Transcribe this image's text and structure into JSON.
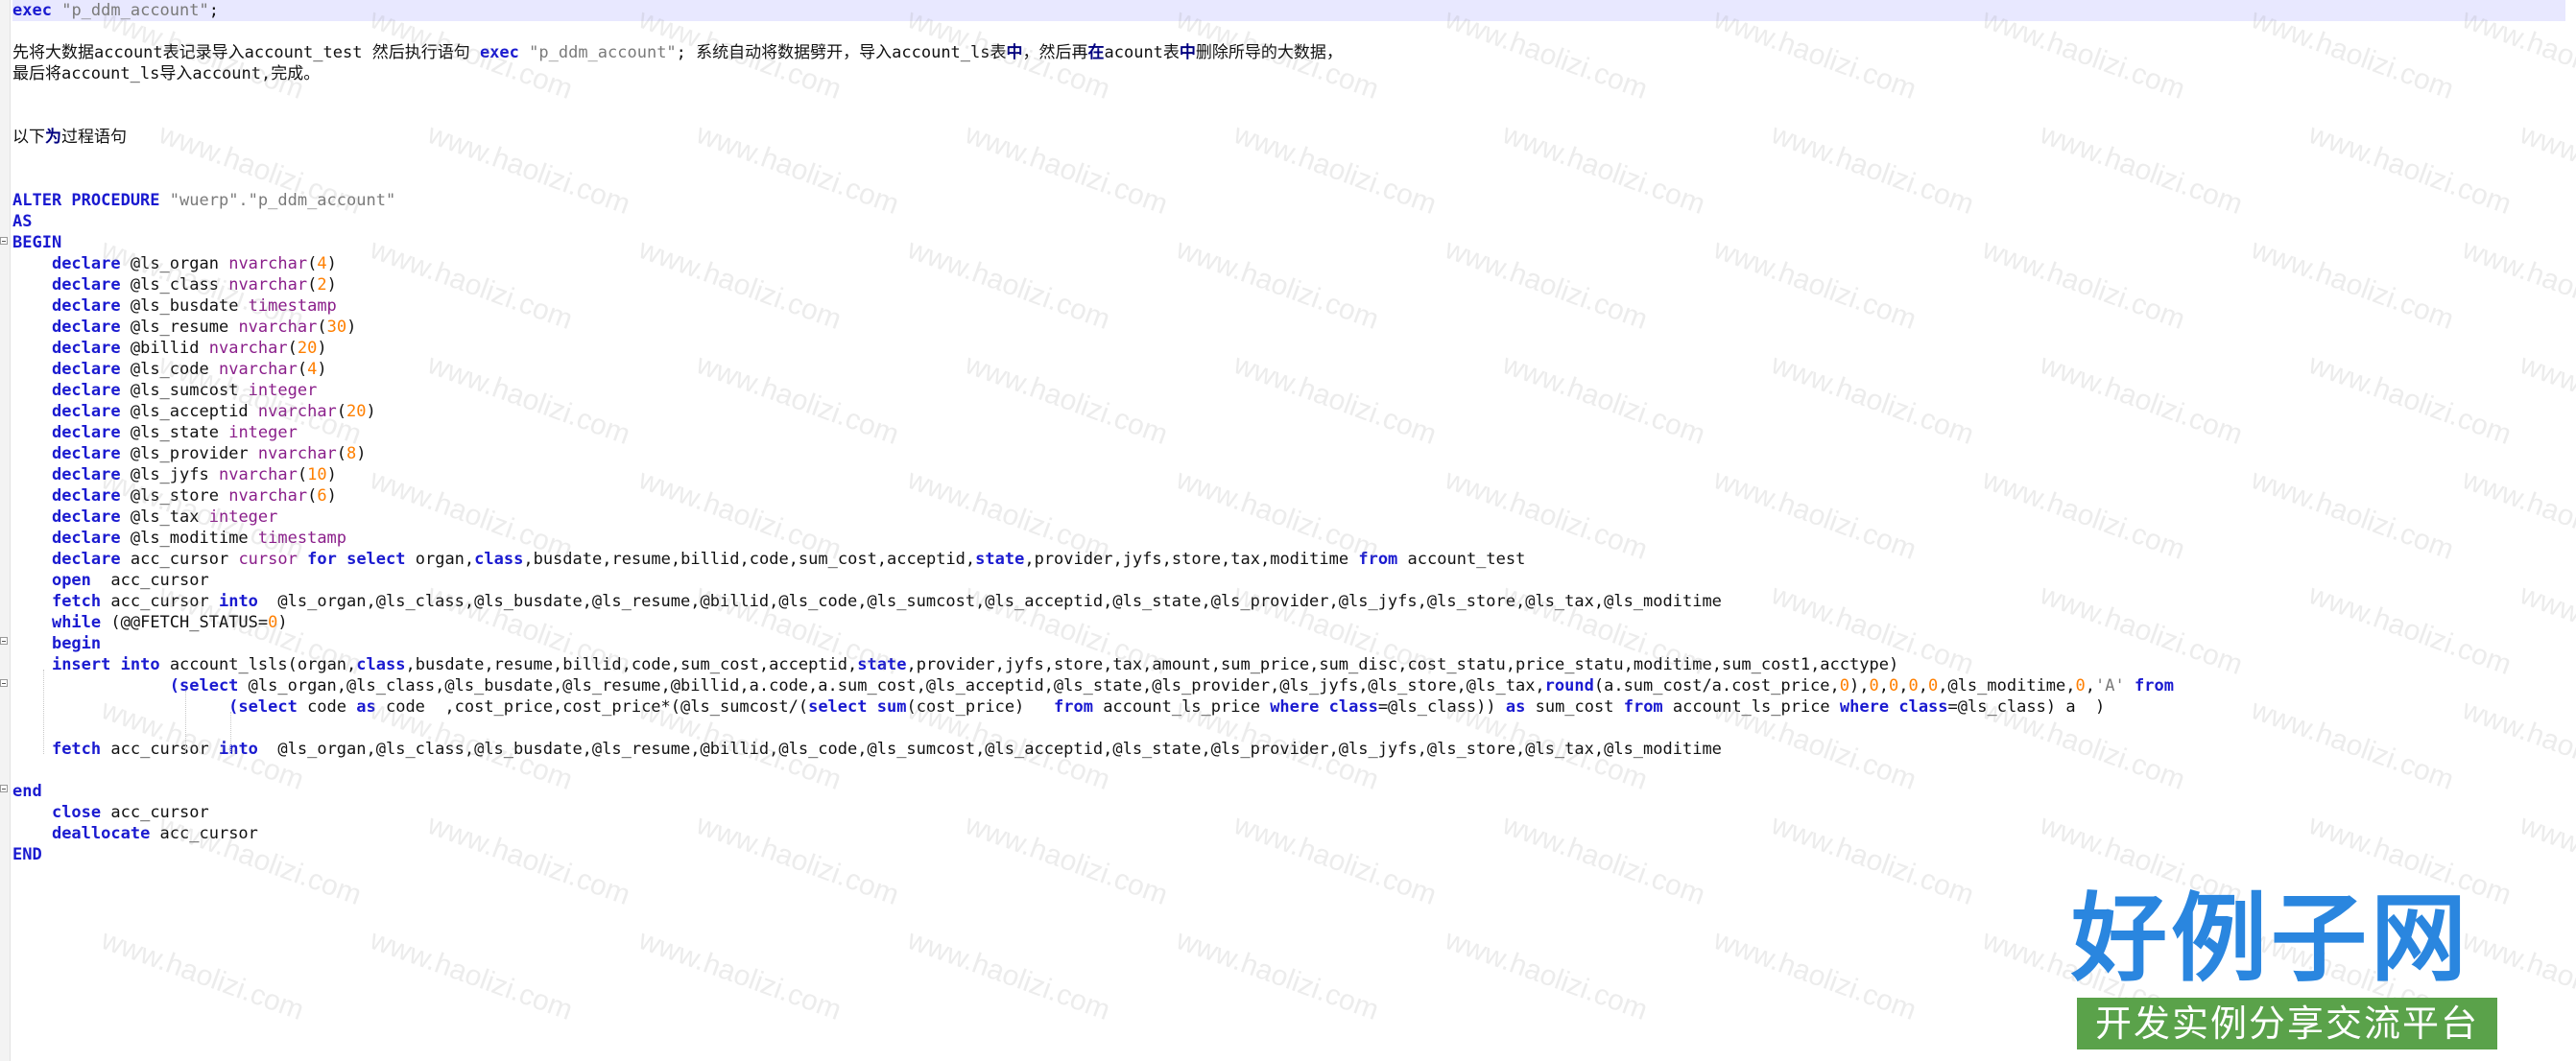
{
  "editor": {
    "lines": [
      [
        {
          "c": "kw",
          "t": "exec"
        },
        {
          "c": "tx",
          "t": " "
        },
        {
          "c": "st",
          "t": "\"p_ddm_account\""
        },
        {
          "c": "tx",
          "t": ";"
        }
      ],
      [],
      [
        {
          "c": "tx",
          "t": "先将大数据account表记录导入account_test 然后执行语句 "
        },
        {
          "c": "kw",
          "t": "exec"
        },
        {
          "c": "tx",
          "t": " "
        },
        {
          "c": "st",
          "t": "\"p_ddm_account\""
        },
        {
          "c": "tx",
          "t": "; 系统自动将数据劈开，导入account_ls表"
        },
        {
          "c": "op",
          "t": "中"
        },
        {
          "c": "tx",
          "t": "，然后再"
        },
        {
          "c": "op",
          "t": "在"
        },
        {
          "c": "tx",
          "t": "acount表"
        },
        {
          "c": "op",
          "t": "中"
        },
        {
          "c": "tx",
          "t": "删除所导的大数据，"
        }
      ],
      [
        {
          "c": "tx",
          "t": "最后将account_ls导入account,完成。"
        }
      ],
      [],
      [],
      [
        {
          "c": "tx",
          "t": "以下"
        },
        {
          "c": "op",
          "t": "为"
        },
        {
          "c": "tx",
          "t": "过程语句"
        }
      ],
      [],
      [],
      [
        {
          "c": "kw",
          "t": "ALTER PROCEDURE"
        },
        {
          "c": "tx",
          "t": " "
        },
        {
          "c": "st",
          "t": "\"wuerp\".\"p_ddm_account\""
        }
      ],
      [
        {
          "c": "kw",
          "t": "AS"
        }
      ],
      [
        {
          "c": "kw",
          "t": "BEGIN"
        }
      ],
      [
        {
          "c": "tx",
          "t": "    "
        },
        {
          "c": "kw",
          "t": "declare"
        },
        {
          "c": "tx",
          "t": " @ls_organ "
        },
        {
          "c": "ty",
          "t": "nvarchar"
        },
        {
          "c": "tx",
          "t": "("
        },
        {
          "c": "nm",
          "t": "4"
        },
        {
          "c": "tx",
          "t": ")"
        }
      ],
      [
        {
          "c": "tx",
          "t": "    "
        },
        {
          "c": "kw",
          "t": "declare"
        },
        {
          "c": "tx",
          "t": " @ls_class "
        },
        {
          "c": "ty",
          "t": "nvarchar"
        },
        {
          "c": "tx",
          "t": "("
        },
        {
          "c": "nm",
          "t": "2"
        },
        {
          "c": "tx",
          "t": ")"
        }
      ],
      [
        {
          "c": "tx",
          "t": "    "
        },
        {
          "c": "kw",
          "t": "declare"
        },
        {
          "c": "tx",
          "t": " @ls_busdate "
        },
        {
          "c": "ty",
          "t": "timestamp"
        }
      ],
      [
        {
          "c": "tx",
          "t": "    "
        },
        {
          "c": "kw",
          "t": "declare"
        },
        {
          "c": "tx",
          "t": " @ls_resume "
        },
        {
          "c": "ty",
          "t": "nvarchar"
        },
        {
          "c": "tx",
          "t": "("
        },
        {
          "c": "nm",
          "t": "30"
        },
        {
          "c": "tx",
          "t": ")"
        }
      ],
      [
        {
          "c": "tx",
          "t": "    "
        },
        {
          "c": "kw",
          "t": "declare"
        },
        {
          "c": "tx",
          "t": " @billid "
        },
        {
          "c": "ty",
          "t": "nvarchar"
        },
        {
          "c": "tx",
          "t": "("
        },
        {
          "c": "nm",
          "t": "20"
        },
        {
          "c": "tx",
          "t": ")"
        }
      ],
      [
        {
          "c": "tx",
          "t": "    "
        },
        {
          "c": "kw",
          "t": "declare"
        },
        {
          "c": "tx",
          "t": " @ls_code "
        },
        {
          "c": "ty",
          "t": "nvarchar"
        },
        {
          "c": "tx",
          "t": "("
        },
        {
          "c": "nm",
          "t": "4"
        },
        {
          "c": "tx",
          "t": ")"
        }
      ],
      [
        {
          "c": "tx",
          "t": "    "
        },
        {
          "c": "kw",
          "t": "declare"
        },
        {
          "c": "tx",
          "t": " @ls_sumcost "
        },
        {
          "c": "ty",
          "t": "integer"
        }
      ],
      [
        {
          "c": "tx",
          "t": "    "
        },
        {
          "c": "kw",
          "t": "declare"
        },
        {
          "c": "tx",
          "t": " @ls_acceptid "
        },
        {
          "c": "ty",
          "t": "nvarchar"
        },
        {
          "c": "tx",
          "t": "("
        },
        {
          "c": "nm",
          "t": "20"
        },
        {
          "c": "tx",
          "t": ")"
        }
      ],
      [
        {
          "c": "tx",
          "t": "    "
        },
        {
          "c": "kw",
          "t": "declare"
        },
        {
          "c": "tx",
          "t": " @ls_state "
        },
        {
          "c": "ty",
          "t": "integer"
        }
      ],
      [
        {
          "c": "tx",
          "t": "    "
        },
        {
          "c": "kw",
          "t": "declare"
        },
        {
          "c": "tx",
          "t": " @ls_provider "
        },
        {
          "c": "ty",
          "t": "nvarchar"
        },
        {
          "c": "tx",
          "t": "("
        },
        {
          "c": "nm",
          "t": "8"
        },
        {
          "c": "tx",
          "t": ")"
        }
      ],
      [
        {
          "c": "tx",
          "t": "    "
        },
        {
          "c": "kw",
          "t": "declare"
        },
        {
          "c": "tx",
          "t": " @ls_jyfs "
        },
        {
          "c": "ty",
          "t": "nvarchar"
        },
        {
          "c": "tx",
          "t": "("
        },
        {
          "c": "nm",
          "t": "10"
        },
        {
          "c": "tx",
          "t": ")"
        }
      ],
      [
        {
          "c": "tx",
          "t": "    "
        },
        {
          "c": "kw",
          "t": "declare"
        },
        {
          "c": "tx",
          "t": " @ls_store "
        },
        {
          "c": "ty",
          "t": "nvarchar"
        },
        {
          "c": "tx",
          "t": "("
        },
        {
          "c": "nm",
          "t": "6"
        },
        {
          "c": "tx",
          "t": ")"
        }
      ],
      [
        {
          "c": "tx",
          "t": "    "
        },
        {
          "c": "kw",
          "t": "declare"
        },
        {
          "c": "tx",
          "t": " @ls_tax "
        },
        {
          "c": "ty",
          "t": "integer"
        }
      ],
      [
        {
          "c": "tx",
          "t": "    "
        },
        {
          "c": "kw",
          "t": "declare"
        },
        {
          "c": "tx",
          "t": " @ls_moditime "
        },
        {
          "c": "ty",
          "t": "timestamp"
        }
      ],
      [
        {
          "c": "tx",
          "t": "    "
        },
        {
          "c": "kw",
          "t": "declare"
        },
        {
          "c": "tx",
          "t": " acc_cursor "
        },
        {
          "c": "ty",
          "t": "cursor"
        },
        {
          "c": "tx",
          "t": " "
        },
        {
          "c": "kw",
          "t": "for"
        },
        {
          "c": "tx",
          "t": " "
        },
        {
          "c": "kw",
          "t": "select"
        },
        {
          "c": "tx",
          "t": " organ,"
        },
        {
          "c": "kw",
          "t": "class"
        },
        {
          "c": "tx",
          "t": ",busdate,resume,billid,code,sum_cost,acceptid,"
        },
        {
          "c": "kw",
          "t": "state"
        },
        {
          "c": "tx",
          "t": ",provider,jyfs,store,tax,moditime "
        },
        {
          "c": "kw",
          "t": "from"
        },
        {
          "c": "tx",
          "t": " account_test"
        }
      ],
      [
        {
          "c": "tx",
          "t": "    "
        },
        {
          "c": "kw",
          "t": "open"
        },
        {
          "c": "tx",
          "t": "  acc_cursor"
        }
      ],
      [
        {
          "c": "tx",
          "t": "    "
        },
        {
          "c": "kw",
          "t": "fetch"
        },
        {
          "c": "tx",
          "t": " acc_cursor "
        },
        {
          "c": "kw",
          "t": "into"
        },
        {
          "c": "tx",
          "t": "  @ls_organ,@ls_class,@ls_busdate,@ls_resume,@billid,@ls_code,@ls_sumcost,@ls_acceptid,@ls_state,@ls_provider,@ls_jyfs,@ls_store,@ls_tax,@ls_moditime"
        }
      ],
      [
        {
          "c": "tx",
          "t": "    "
        },
        {
          "c": "kw",
          "t": "while"
        },
        {
          "c": "tx",
          "t": " (@@FETCH_STATUS="
        },
        {
          "c": "nm",
          "t": "0"
        },
        {
          "c": "tx",
          "t": ")"
        }
      ],
      [
        {
          "c": "tx",
          "t": "    "
        },
        {
          "c": "kw",
          "t": "begin"
        }
      ],
      [
        {
          "c": "tx",
          "t": "    "
        },
        {
          "c": "kw",
          "t": "insert"
        },
        {
          "c": "tx",
          "t": " "
        },
        {
          "c": "kw",
          "t": "into"
        },
        {
          "c": "tx",
          "t": " account_lsls(organ,"
        },
        {
          "c": "kw",
          "t": "class"
        },
        {
          "c": "tx",
          "t": ",busdate,resume,billid,code,sum_cost,acceptid,"
        },
        {
          "c": "kw",
          "t": "state"
        },
        {
          "c": "tx",
          "t": ",provider,jyfs,store,tax,amount,sum_price,sum_disc,cost_statu,price_statu,moditime,sum_cost1,acctype)"
        }
      ],
      [
        {
          "c": "tx",
          "t": "                "
        },
        {
          "c": "kw",
          "t": "(select"
        },
        {
          "c": "tx",
          "t": " @ls_organ,@ls_class,@ls_busdate,@ls_resume,@billid,a.code,a.sum_cost,@ls_acceptid,@ls_state,@ls_provider,@ls_jyfs,@ls_store,@ls_tax,"
        },
        {
          "c": "kw",
          "t": "round"
        },
        {
          "c": "tx",
          "t": "(a.sum_cost/a.cost_price,"
        },
        {
          "c": "nm",
          "t": "0"
        },
        {
          "c": "tx",
          "t": "),"
        },
        {
          "c": "nm",
          "t": "0"
        },
        {
          "c": "tx",
          "t": ","
        },
        {
          "c": "nm",
          "t": "0"
        },
        {
          "c": "tx",
          "t": ","
        },
        {
          "c": "nm",
          "t": "0"
        },
        {
          "c": "tx",
          "t": ","
        },
        {
          "c": "nm",
          "t": "0"
        },
        {
          "c": "tx",
          "t": ",@ls_moditime,"
        },
        {
          "c": "nm",
          "t": "0"
        },
        {
          "c": "tx",
          "t": ","
        },
        {
          "c": "st",
          "t": "'A'"
        },
        {
          "c": "tx",
          "t": " "
        },
        {
          "c": "kw",
          "t": "from"
        }
      ],
      [
        {
          "c": "tx",
          "t": "                      "
        },
        {
          "c": "kw",
          "t": "(select"
        },
        {
          "c": "tx",
          "t": " code "
        },
        {
          "c": "kw",
          "t": "as"
        },
        {
          "c": "tx",
          "t": " code  ,cost_price,cost_price*(@ls_sumcost/("
        },
        {
          "c": "kw",
          "t": "select"
        },
        {
          "c": "tx",
          "t": " "
        },
        {
          "c": "kw",
          "t": "sum"
        },
        {
          "c": "tx",
          "t": "(cost_price)   "
        },
        {
          "c": "kw",
          "t": "from"
        },
        {
          "c": "tx",
          "t": " account_ls_price "
        },
        {
          "c": "kw",
          "t": "where"
        },
        {
          "c": "tx",
          "t": " "
        },
        {
          "c": "kw",
          "t": "class"
        },
        {
          "c": "tx",
          "t": "=@ls_class)) "
        },
        {
          "c": "kw",
          "t": "as"
        },
        {
          "c": "tx",
          "t": " sum_cost "
        },
        {
          "c": "kw",
          "t": "from"
        },
        {
          "c": "tx",
          "t": " account_ls_price "
        },
        {
          "c": "kw",
          "t": "where"
        },
        {
          "c": "tx",
          "t": " "
        },
        {
          "c": "kw",
          "t": "class"
        },
        {
          "c": "tx",
          "t": "=@ls_class) a  )"
        }
      ],
      [],
      [
        {
          "c": "tx",
          "t": "    "
        },
        {
          "c": "kw",
          "t": "fetch"
        },
        {
          "c": "tx",
          "t": " acc_cursor "
        },
        {
          "c": "kw",
          "t": "into"
        },
        {
          "c": "tx",
          "t": "  @ls_organ,@ls_class,@ls_busdate,@ls_resume,@billid,@ls_code,@ls_sumcost,@ls_acceptid,@ls_state,@ls_provider,@ls_jyfs,@ls_store,@ls_tax,@ls_moditime"
        }
      ],
      [],
      [
        {
          "c": "kw",
          "t": "end"
        }
      ],
      [
        {
          "c": "tx",
          "t": "    "
        },
        {
          "c": "kw",
          "t": "close"
        },
        {
          "c": "tx",
          "t": " acc_cursor"
        }
      ],
      [
        {
          "c": "tx",
          "t": "    "
        },
        {
          "c": "kw",
          "t": "deallocate"
        },
        {
          "c": "tx",
          "t": " acc_cursor"
        }
      ],
      [
        {
          "c": "kw",
          "t": "END"
        }
      ]
    ],
    "colors": {
      "keyword": "#1a1ad0",
      "type": "#8a1e8a",
      "number": "#ff7f00",
      "string": "#7a7a7a",
      "current_line": "#e8e8ff"
    }
  },
  "watermark": {
    "text": "www.haolizi.com"
  },
  "logo": {
    "title": "好例子网",
    "subtitle": "开发实例分享交流平台",
    "title_color": "#2a86df",
    "subtitle_bg": "#5aa24a"
  }
}
